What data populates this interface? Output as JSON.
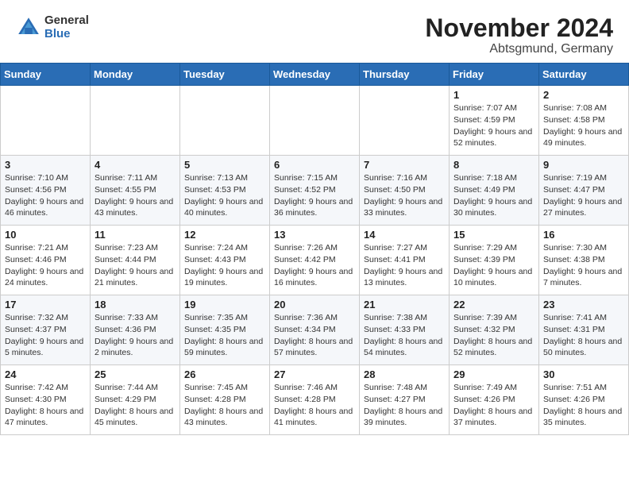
{
  "header": {
    "logo_general": "General",
    "logo_blue": "Blue",
    "title": "November 2024",
    "subtitle": "Abtsgmund, Germany"
  },
  "calendar": {
    "days_of_week": [
      "Sunday",
      "Monday",
      "Tuesday",
      "Wednesday",
      "Thursday",
      "Friday",
      "Saturday"
    ],
    "weeks": [
      [
        {
          "day": "",
          "info": ""
        },
        {
          "day": "",
          "info": ""
        },
        {
          "day": "",
          "info": ""
        },
        {
          "day": "",
          "info": ""
        },
        {
          "day": "",
          "info": ""
        },
        {
          "day": "1",
          "info": "Sunrise: 7:07 AM\nSunset: 4:59 PM\nDaylight: 9 hours and 52 minutes."
        },
        {
          "day": "2",
          "info": "Sunrise: 7:08 AM\nSunset: 4:58 PM\nDaylight: 9 hours and 49 minutes."
        }
      ],
      [
        {
          "day": "3",
          "info": "Sunrise: 7:10 AM\nSunset: 4:56 PM\nDaylight: 9 hours and 46 minutes."
        },
        {
          "day": "4",
          "info": "Sunrise: 7:11 AM\nSunset: 4:55 PM\nDaylight: 9 hours and 43 minutes."
        },
        {
          "day": "5",
          "info": "Sunrise: 7:13 AM\nSunset: 4:53 PM\nDaylight: 9 hours and 40 minutes."
        },
        {
          "day": "6",
          "info": "Sunrise: 7:15 AM\nSunset: 4:52 PM\nDaylight: 9 hours and 36 minutes."
        },
        {
          "day": "7",
          "info": "Sunrise: 7:16 AM\nSunset: 4:50 PM\nDaylight: 9 hours and 33 minutes."
        },
        {
          "day": "8",
          "info": "Sunrise: 7:18 AM\nSunset: 4:49 PM\nDaylight: 9 hours and 30 minutes."
        },
        {
          "day": "9",
          "info": "Sunrise: 7:19 AM\nSunset: 4:47 PM\nDaylight: 9 hours and 27 minutes."
        }
      ],
      [
        {
          "day": "10",
          "info": "Sunrise: 7:21 AM\nSunset: 4:46 PM\nDaylight: 9 hours and 24 minutes."
        },
        {
          "day": "11",
          "info": "Sunrise: 7:23 AM\nSunset: 4:44 PM\nDaylight: 9 hours and 21 minutes."
        },
        {
          "day": "12",
          "info": "Sunrise: 7:24 AM\nSunset: 4:43 PM\nDaylight: 9 hours and 19 minutes."
        },
        {
          "day": "13",
          "info": "Sunrise: 7:26 AM\nSunset: 4:42 PM\nDaylight: 9 hours and 16 minutes."
        },
        {
          "day": "14",
          "info": "Sunrise: 7:27 AM\nSunset: 4:41 PM\nDaylight: 9 hours and 13 minutes."
        },
        {
          "day": "15",
          "info": "Sunrise: 7:29 AM\nSunset: 4:39 PM\nDaylight: 9 hours and 10 minutes."
        },
        {
          "day": "16",
          "info": "Sunrise: 7:30 AM\nSunset: 4:38 PM\nDaylight: 9 hours and 7 minutes."
        }
      ],
      [
        {
          "day": "17",
          "info": "Sunrise: 7:32 AM\nSunset: 4:37 PM\nDaylight: 9 hours and 5 minutes."
        },
        {
          "day": "18",
          "info": "Sunrise: 7:33 AM\nSunset: 4:36 PM\nDaylight: 9 hours and 2 minutes."
        },
        {
          "day": "19",
          "info": "Sunrise: 7:35 AM\nSunset: 4:35 PM\nDaylight: 8 hours and 59 minutes."
        },
        {
          "day": "20",
          "info": "Sunrise: 7:36 AM\nSunset: 4:34 PM\nDaylight: 8 hours and 57 minutes."
        },
        {
          "day": "21",
          "info": "Sunrise: 7:38 AM\nSunset: 4:33 PM\nDaylight: 8 hours and 54 minutes."
        },
        {
          "day": "22",
          "info": "Sunrise: 7:39 AM\nSunset: 4:32 PM\nDaylight: 8 hours and 52 minutes."
        },
        {
          "day": "23",
          "info": "Sunrise: 7:41 AM\nSunset: 4:31 PM\nDaylight: 8 hours and 50 minutes."
        }
      ],
      [
        {
          "day": "24",
          "info": "Sunrise: 7:42 AM\nSunset: 4:30 PM\nDaylight: 8 hours and 47 minutes."
        },
        {
          "day": "25",
          "info": "Sunrise: 7:44 AM\nSunset: 4:29 PM\nDaylight: 8 hours and 45 minutes."
        },
        {
          "day": "26",
          "info": "Sunrise: 7:45 AM\nSunset: 4:28 PM\nDaylight: 8 hours and 43 minutes."
        },
        {
          "day": "27",
          "info": "Sunrise: 7:46 AM\nSunset: 4:28 PM\nDaylight: 8 hours and 41 minutes."
        },
        {
          "day": "28",
          "info": "Sunrise: 7:48 AM\nSunset: 4:27 PM\nDaylight: 8 hours and 39 minutes."
        },
        {
          "day": "29",
          "info": "Sunrise: 7:49 AM\nSunset: 4:26 PM\nDaylight: 8 hours and 37 minutes."
        },
        {
          "day": "30",
          "info": "Sunrise: 7:51 AM\nSunset: 4:26 PM\nDaylight: 8 hours and 35 minutes."
        }
      ]
    ]
  }
}
